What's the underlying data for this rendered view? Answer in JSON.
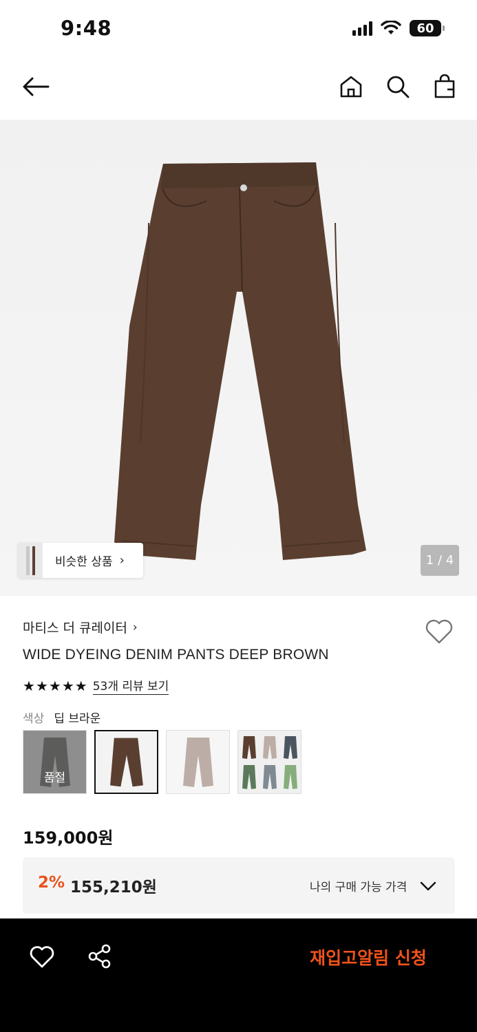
{
  "status_bar": {
    "time": "9:48",
    "battery": "60"
  },
  "nav": {
    "icons": [
      "arrow-left-icon",
      "home-icon",
      "search-icon",
      "shopping-bag-icon"
    ]
  },
  "hero": {
    "similar_label": "비슷한 상품",
    "page_indicator": "1 / 4",
    "background_color": "#f3f3f3",
    "product_color": "#5a3f30"
  },
  "product": {
    "brand": "마티스 더 큐레이터",
    "title": "WIDE DYEING DENIM PANTS DEEP BROWN",
    "rating_stars": 5,
    "review_link": "53개 리뷰 보기",
    "color_label": "색상",
    "color_value": "딥 브라운",
    "swatches": [
      {
        "name": "gray",
        "color": "#6f716c",
        "soldout_text": "품절"
      },
      {
        "name": "deep-brown",
        "color": "#5a3f30",
        "selected": true
      },
      {
        "name": "beige",
        "color": "#bcaea6"
      },
      {
        "name": "all-colors",
        "colors": [
          "#5a3f30",
          "#bcaea6",
          "#4b5560",
          "#5b7a5b",
          "#7f8a93",
          "#86ae7c"
        ]
      }
    ],
    "price": "159,000원"
  },
  "member_price": {
    "discount": "2%",
    "price": "155,210원",
    "label": "나의 구매 가능 가격"
  },
  "bottom_bar": {
    "restock_label": "재입고알림 신청",
    "accent_color": "#f0521a"
  }
}
